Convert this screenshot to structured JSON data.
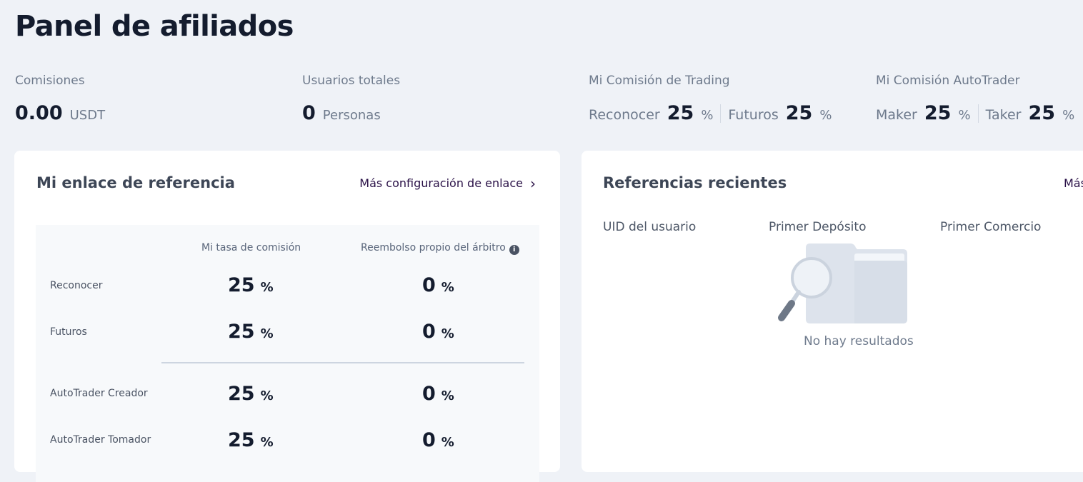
{
  "page": {
    "title": "Panel de afiliados"
  },
  "stats": {
    "commissions": {
      "label": "Comisiones",
      "value": "0.00",
      "unit": "USDT"
    },
    "total_users": {
      "label": "Usuarios totales",
      "value": "0",
      "unit": "Personas"
    },
    "trading_commission": {
      "label": "Mi Comisión de Trading",
      "items": [
        {
          "label": "Reconocer",
          "value": "25",
          "unit": "%"
        },
        {
          "label": "Futuros",
          "value": "25",
          "unit": "%"
        }
      ]
    },
    "autotrader_commission": {
      "label": "Mi Comisión AutoTrader",
      "items": [
        {
          "label": "Maker",
          "value": "25",
          "unit": "%"
        },
        {
          "label": "Taker",
          "value": "25",
          "unit": "%"
        }
      ]
    }
  },
  "referral_link": {
    "title": "Mi enlace de referencia",
    "more_link": "Más configuración de enlace",
    "table": {
      "columns": [
        "Mi tasa de comisión",
        "Reembolso propio del árbitro"
      ],
      "rows": [
        {
          "label": "Reconocer",
          "rate": "25",
          "rebate": "0",
          "unit": "%"
        },
        {
          "label": "Futuros",
          "rate": "25",
          "rebate": "0",
          "unit": "%"
        },
        {
          "label": "AutoTrader Creador",
          "rate": "25",
          "rebate": "0",
          "unit": "%"
        },
        {
          "label": "AutoTrader Tomador",
          "rate": "25",
          "rebate": "0",
          "unit": "%"
        }
      ]
    }
  },
  "recent_referrals": {
    "title": "Referencias recientes",
    "more_link": "Más",
    "columns": [
      "UID del usuario",
      "Primer Depósito",
      "Primer Comercio"
    ],
    "empty_text": "No hay resultados"
  },
  "icons": {
    "chevron": "chevron-right-icon",
    "info": "info-icon",
    "empty": "empty-folder-search-icon"
  }
}
